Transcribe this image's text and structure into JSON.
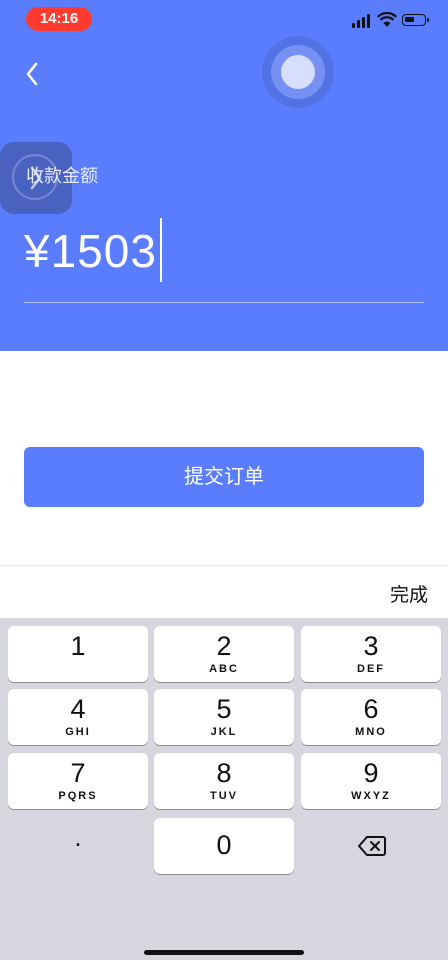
{
  "status_bar": {
    "time": "14:16",
    "time_pill_color": "#ff3b30"
  },
  "header": {
    "background": "#5a7dff",
    "label": "收款金额",
    "currency_symbol": "¥",
    "amount": "1503"
  },
  "actions": {
    "submit_label": "提交订单"
  },
  "keyboard": {
    "toolbar_done": "完成",
    "keys": [
      {
        "num": "1",
        "letters": ""
      },
      {
        "num": "2",
        "letters": "ABC"
      },
      {
        "num": "3",
        "letters": "DEF"
      },
      {
        "num": "4",
        "letters": "GHI"
      },
      {
        "num": "5",
        "letters": "JKL"
      },
      {
        "num": "6",
        "letters": "MNO"
      },
      {
        "num": "7",
        "letters": "PQRS"
      },
      {
        "num": "8",
        "letters": "TUV"
      },
      {
        "num": "9",
        "letters": "WXYZ"
      },
      {
        "num": ".",
        "letters": ""
      },
      {
        "num": "0",
        "letters": ""
      }
    ],
    "delete_icon": "backspace-icon"
  },
  "colors": {
    "accent": "#5a7dff",
    "keyboard_bg": "#d6d7de"
  }
}
